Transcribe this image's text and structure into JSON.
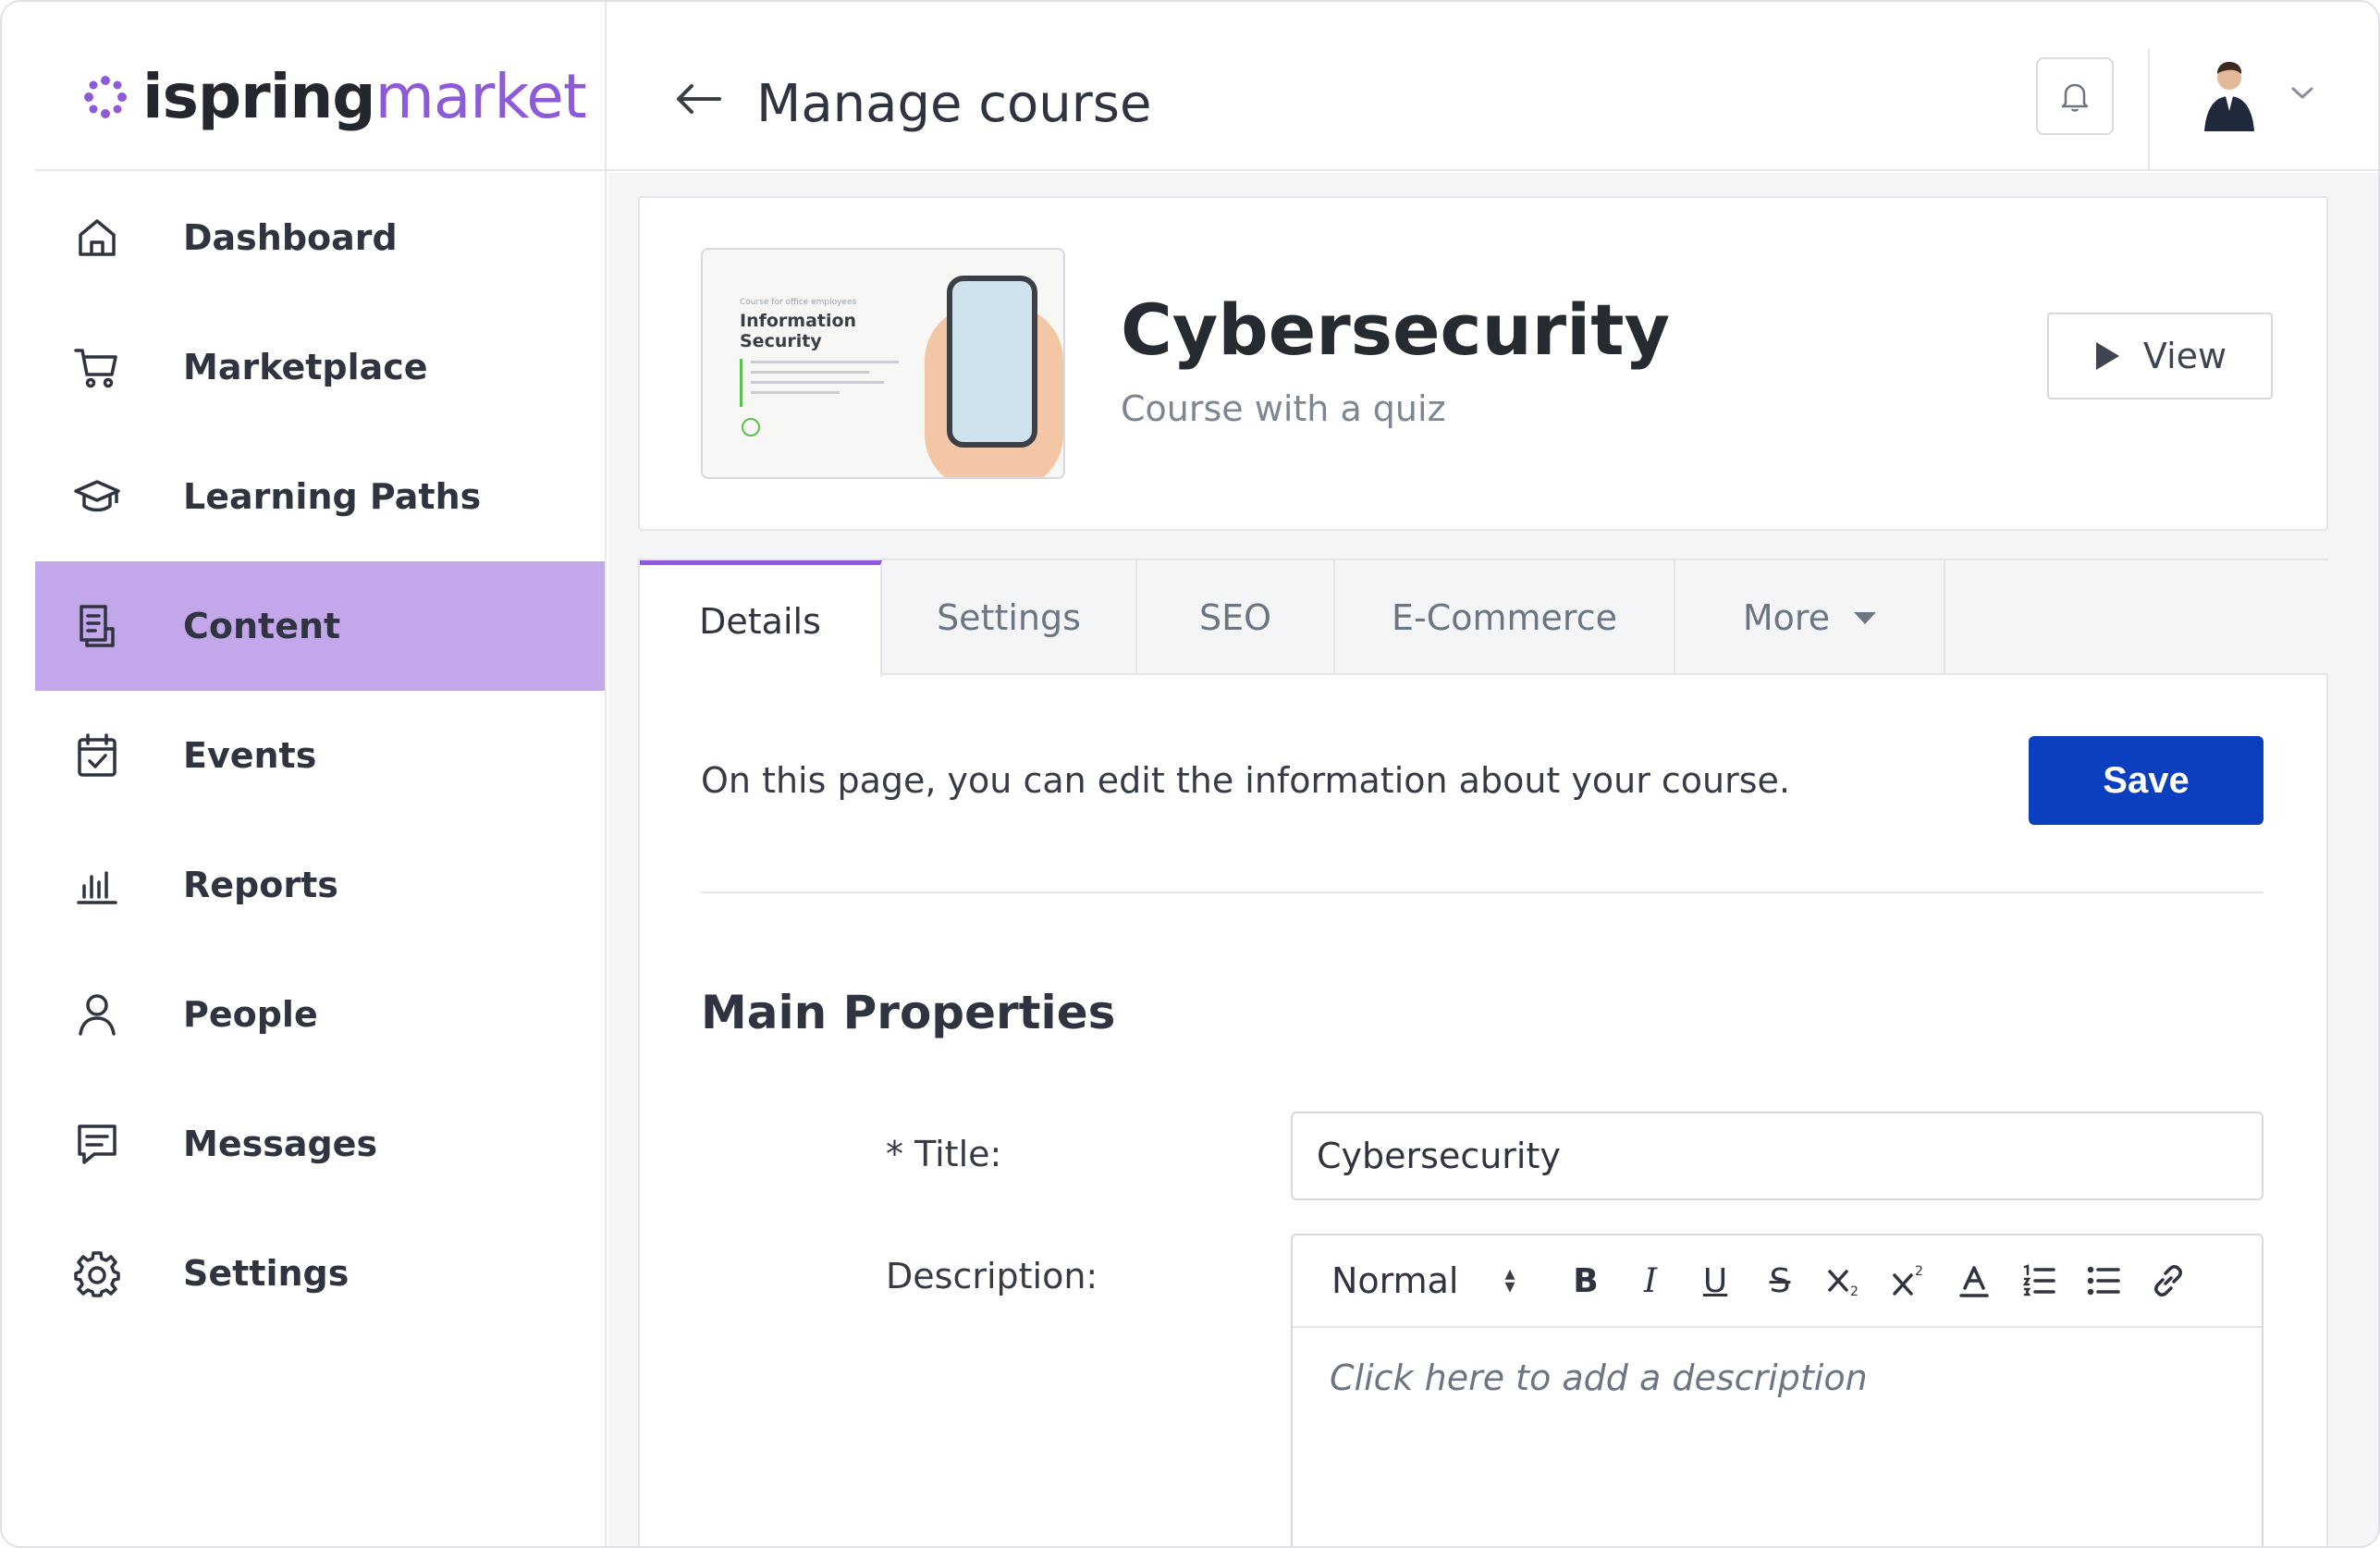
{
  "brand": {
    "logo_part1": "ispring",
    "logo_part2": "market",
    "accent": "#8e5bd8"
  },
  "sidebar": {
    "items": [
      {
        "label": "Dashboard",
        "icon": "home-icon",
        "active": false
      },
      {
        "label": "Marketplace",
        "icon": "cart-icon",
        "active": false
      },
      {
        "label": "Learning Paths",
        "icon": "graduation-cap-icon",
        "active": false
      },
      {
        "label": "Content",
        "icon": "document-icon",
        "active": true
      },
      {
        "label": "Events",
        "icon": "calendar-check-icon",
        "active": false
      },
      {
        "label": "Reports",
        "icon": "bar-chart-icon",
        "active": false
      },
      {
        "label": "People",
        "icon": "person-icon",
        "active": false
      },
      {
        "label": "Messages",
        "icon": "message-icon",
        "active": false
      },
      {
        "label": "Settings",
        "icon": "gear-icon",
        "active": false
      }
    ],
    "active_bg": "#c2a7ea"
  },
  "header": {
    "title": "Manage course"
  },
  "course": {
    "name": "Cybersecurity",
    "subtitle": "Course with a quiz",
    "view_label": "View",
    "thumbnail": {
      "small_text": "Course for office employees",
      "title": "Information Security"
    }
  },
  "tabs": [
    {
      "label": "Details",
      "active": true
    },
    {
      "label": "Settings",
      "active": false
    },
    {
      "label": "SEO",
      "active": false
    },
    {
      "label": "E-Commerce",
      "active": false
    },
    {
      "label": "More",
      "active": false
    }
  ],
  "details": {
    "intro": "On this page, you can edit the information about your course.",
    "save_label": "Save",
    "save_color": "#0b3fbf",
    "section_title": "Main Properties",
    "title_label": "* Title:",
    "title_value": "Cybersecurity",
    "description_label": "Description:",
    "description_placeholder": "Click here to add a description",
    "toolbar": {
      "format": "Normal",
      "bold": "B",
      "italic": "I",
      "underline": "U",
      "strike": "S"
    }
  }
}
